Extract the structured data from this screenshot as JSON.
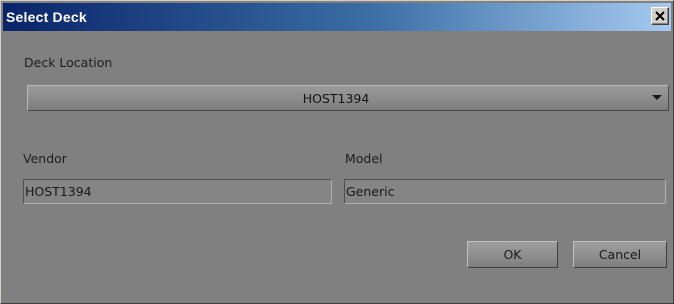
{
  "window": {
    "title": "Select Deck",
    "close_icon": "close-icon"
  },
  "deck_location": {
    "label": "Deck Location",
    "selected": "HOST1394"
  },
  "vendor": {
    "label": "Vendor",
    "value": "HOST1394"
  },
  "model": {
    "label": "Model",
    "value": "Generic"
  },
  "buttons": {
    "ok": "OK",
    "cancel": "Cancel"
  },
  "colors": {
    "title_gradient_start": "#0a246a",
    "title_gradient_end": "#a6caf0",
    "body_background": "#808080"
  }
}
